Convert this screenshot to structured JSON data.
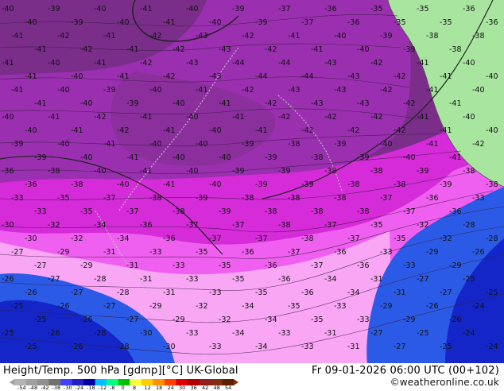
{
  "map": {
    "title": "Height/Temp. 500 hPa [gdmp][°C] UK-Global",
    "valid_time": "Fr 09-01-2026 06:00 UTC (00+102)",
    "credit": "©weatheronline.co.uk",
    "colors": {
      "land_green": "#a8e6a0",
      "sea_white": "#f4f4f4",
      "deep_purple": "#7a2e8a",
      "purple": "#9a2fb0",
      "magenta": "#d52bd8",
      "pink": "#f060f0",
      "light_pink": "#f9a6f5",
      "blue": "#2b5be6",
      "deep_blue": "#1526c8",
      "contour": "#222222"
    },
    "colorbar": {
      "labels": [
        "-54",
        "-48",
        "-42",
        "-38",
        "-30",
        "-24",
        "-18",
        "-12",
        "-8",
        "0",
        "8",
        "12",
        "18",
        "24",
        "30",
        "36",
        "42",
        "48",
        "54"
      ],
      "colors": [
        "#b4b4b4",
        "#a0a0a0",
        "#909090",
        "#707070",
        "#4040ff",
        "#2020c0",
        "#0000a0",
        "#00c0ff",
        "#00ff80",
        "#00c000",
        "#ffff40",
        "#ffd000",
        "#ff9000",
        "#ff4000",
        "#e00000",
        "#b00000",
        "#902020",
        "#803010",
        "#602000"
      ]
    },
    "contour_labels": {
      "row1": [
        "-40",
        "-39",
        "-40",
        "-41",
        "-40",
        "-39",
        "-37",
        "-36",
        "-35",
        "-35",
        "-36"
      ],
      "row2": [
        "-41",
        "-42",
        "-41",
        "-42",
        "-43",
        "-42",
        "-41",
        "-40",
        "-39",
        "-38",
        "-38"
      ],
      "row3": [
        "-41",
        "-40",
        "-41",
        "-42",
        "-43",
        "-44",
        "-44",
        "-43",
        "-42",
        "-41",
        "-40"
      ],
      "row4": [
        "-41",
        "-40",
        "-39",
        "-40",
        "-41",
        "-42",
        "-43",
        "-43",
        "-42",
        "-41",
        "-40"
      ],
      "row5": [
        "-40",
        "-41",
        "-42",
        "-41",
        "-40",
        "-41",
        "-42",
        "-42",
        "-42",
        "-41",
        "-40"
      ],
      "row6": [
        "-39",
        "-40",
        "-41",
        "-40",
        "-40",
        "-39",
        "-38",
        "-39",
        "-40",
        "-41",
        "-42"
      ],
      "row7": [
        "-36",
        "-38",
        "-40",
        "-41",
        "-40",
        "-39",
        "-39",
        "-38",
        "-38",
        "-39",
        "-38"
      ],
      "row8": [
        "-33",
        "-35",
        "-37",
        "-38",
        "-39",
        "-38",
        "-38",
        "-38",
        "-37",
        "-36",
        "-33"
      ],
      "row9": [
        "-30",
        "-32",
        "-34",
        "-36",
        "-37",
        "-37",
        "-38",
        "-37",
        "-35",
        "-32",
        "-28"
      ],
      "row10": [
        "-27",
        "-29",
        "-31",
        "-33",
        "-35",
        "-36",
        "-37",
        "-36",
        "-33",
        "-29",
        "-26"
      ],
      "row11": [
        "-26",
        "-27",
        "-28",
        "-31",
        "-33",
        "-35",
        "-36",
        "-34",
        "-31",
        "-27",
        "-25"
      ],
      "row12": [
        "-25",
        "-26",
        "-27",
        "-29",
        "-32",
        "-34",
        "-35",
        "-33",
        "-29",
        "-26",
        "-24"
      ],
      "row13": [
        "-25",
        "-26",
        "-28",
        "-30",
        "-33",
        "-34",
        "-33",
        "-31",
        "-27",
        "-25",
        "-24"
      ]
    }
  }
}
